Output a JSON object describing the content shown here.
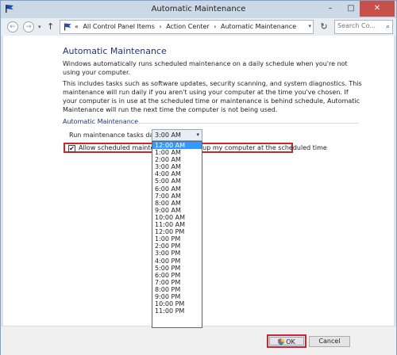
{
  "window": {
    "title": "Automatic Maintenance",
    "controls": {
      "minimize": "–",
      "maximize": "□",
      "close": "✕"
    }
  },
  "nav": {
    "back": "←",
    "forward": "→",
    "recent": "▾",
    "up": "↑",
    "breadcrumbs": [
      "«",
      "All Control Panel Items",
      "›",
      "Action Center",
      "›",
      "Automatic Maintenance"
    ],
    "address_dropdown": "▾",
    "refresh": "↻",
    "search_placeholder": "Search Co...",
    "search_icon": "⌕"
  },
  "main": {
    "heading": "Automatic Maintenance",
    "intro": "Windows automatically runs scheduled maintenance on a daily schedule when you're not using your computer.",
    "details": "This includes tasks such as software updates, security scanning, and system diagnostics. This maintenance will run daily if you aren't using your computer at the time you've chosen. If your computer is in use at the scheduled time or maintenance is behind schedule, Automatic Maintenance will run the next time the computer is not being used.",
    "group_label": "Automatic Maintenance",
    "schedule_label": "Run maintenance tasks daily at",
    "schedule_value": "3:00 AM",
    "dropdown_chevron": "▾",
    "allow_checked": true,
    "allow_check_glyph": "✔",
    "allow_label": "Allow scheduled maintenance to wake up my computer at the scheduled time",
    "options": [
      "12:00 AM",
      "1:00 AM",
      "2:00 AM",
      "3:00 AM",
      "4:00 AM",
      "5:00 AM",
      "6:00 AM",
      "7:00 AM",
      "8:00 AM",
      "9:00 AM",
      "10:00 AM",
      "11:00 AM",
      "12:00 PM",
      "1:00 PM",
      "2:00 PM",
      "3:00 PM",
      "4:00 PM",
      "5:00 PM",
      "6:00 PM",
      "7:00 PM",
      "8:00 PM",
      "9:00 PM",
      "10:00 PM",
      "11:00 PM"
    ],
    "highlighted_option": "12:00 AM"
  },
  "footer": {
    "ok": "OK",
    "cancel": "Cancel"
  },
  "colors": {
    "accent": "#3399ff",
    "highlight_border": "#d2232a",
    "heading": "#1e3287",
    "flag": "#1f4bb3"
  }
}
